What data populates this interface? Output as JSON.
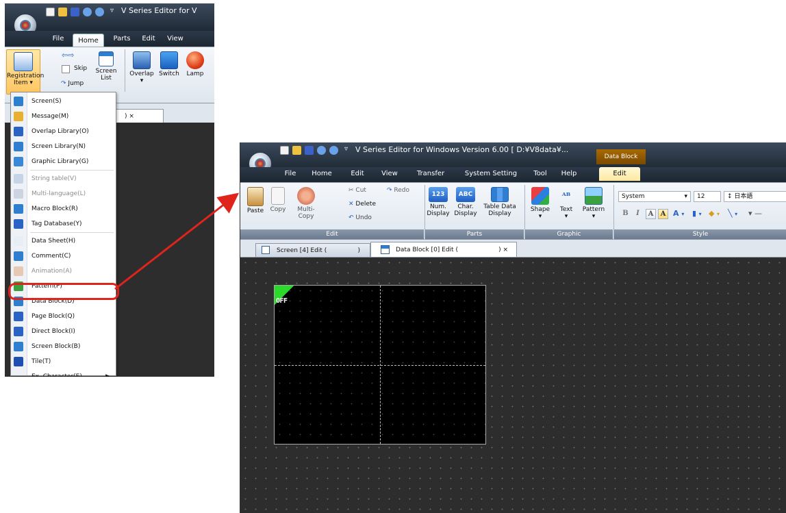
{
  "small_window": {
    "title": "V Series Editor for V",
    "tabs": [
      "File",
      "Home",
      "Parts",
      "Edit",
      "View"
    ],
    "active_tab": "Home",
    "ribbon": {
      "registration_item": "Registration Item",
      "registration_item_line1": "Registration",
      "registration_item_line2": "Item",
      "skip": "Skip",
      "jump": "Jump",
      "screen_list": "Screen List",
      "screen_list_line1": "Screen",
      "screen_list_line2": "List",
      "overlap": "Overlap",
      "switch": "Switch",
      "lamp": "Lamp"
    },
    "doc_tab_close": ")  ×",
    "menu_items": [
      {
        "label": "Screen(S)",
        "enabled": true,
        "icon": "screen-icon"
      },
      {
        "label": "Message(M)",
        "enabled": true,
        "icon": "message-icon"
      },
      {
        "label": "Overlap Library(O)",
        "enabled": true,
        "icon": "overlap-library-icon"
      },
      {
        "label": "Screen Library(N)",
        "enabled": true,
        "icon": "screen-library-icon"
      },
      {
        "label": "Graphic Library(G)",
        "enabled": true,
        "icon": "graphic-library-icon"
      },
      {
        "label": "String table(V)",
        "enabled": false,
        "icon": "string-table-icon"
      },
      {
        "label": "Multi-language(L)",
        "enabled": false,
        "icon": "multi-language-icon"
      },
      {
        "label": "Macro Block(R)",
        "enabled": true,
        "icon": "macro-block-icon"
      },
      {
        "label": "Tag Database(Y)",
        "enabled": true,
        "icon": "tag-database-icon"
      },
      {
        "label": "Data Sheet(H)",
        "enabled": true,
        "icon": "data-sheet-icon"
      },
      {
        "label": "Comment(C)",
        "enabled": true,
        "icon": "comment-icon"
      },
      {
        "label": "Animation(A)",
        "enabled": false,
        "icon": "animation-icon"
      },
      {
        "label": "Pattern(P)",
        "enabled": true,
        "icon": "pattern-icon"
      },
      {
        "label": "Data Block(D)",
        "enabled": true,
        "icon": "data-block-icon",
        "highlighted": true
      },
      {
        "label": "Page Block(Q)",
        "enabled": true,
        "icon": "page-block-icon"
      },
      {
        "label": "Direct Block(I)",
        "enabled": true,
        "icon": "direct-block-icon"
      },
      {
        "label": "Screen Block(B)",
        "enabled": true,
        "icon": "screen-block-icon"
      },
      {
        "label": "Tile(T)",
        "enabled": true,
        "icon": "tile-icon"
      },
      {
        "label": "Ex. Character(E)",
        "enabled": true,
        "icon": "",
        "submenu": true
      }
    ]
  },
  "main_window": {
    "title": "V Series Editor for Windows Version 6.00 [ D:¥V8data¥...",
    "context_group": "Data Block",
    "tabs": [
      "File",
      "Home",
      "Edit",
      "View",
      "Transfer",
      "System Setting",
      "Tool",
      "Help",
      "Edit"
    ],
    "active_tab": "Edit",
    "groups": {
      "edit": {
        "label": "Edit",
        "paste": "Paste",
        "copy": "Copy",
        "multi_copy": "Multi-Copy",
        "cut": "Cut",
        "delete": "Delete",
        "undo": "Undo",
        "redo": "Redo"
      },
      "parts": {
        "label": "Parts",
        "num_display": "Num. Display",
        "num_display_line1": "Num.",
        "num_display_line2": "Display",
        "char_display": "Char. Display",
        "char_display_line1": "Char.",
        "char_display_line2": "Display",
        "table_data_display": "Table Data Display",
        "table_data_display_line1": "Table Data",
        "table_data_display_line2": "Display",
        "num_icon_text": "123",
        "char_icon_text": "ABC"
      },
      "graphic": {
        "label": "Graphic",
        "shape": "Shape",
        "text": "Text",
        "pattern": "Pattern"
      },
      "style": {
        "label": "Style",
        "font": "System",
        "size": "12",
        "language": "日本語"
      }
    },
    "doc_tabs": [
      {
        "label": "Screen [4] Edit (",
        "suffix": ")",
        "active": false
      },
      {
        "label": "Data Block [0] Edit (",
        "suffix": ")  ×",
        "active": true
      }
    ],
    "canvas_label": "OFF"
  },
  "colors": {
    "highlight_ring": "#e0241b",
    "arrow": "#e0241b",
    "workspace": "#2d2d2d",
    "canvas": "#000000",
    "off_badge": "#2bd92b"
  }
}
